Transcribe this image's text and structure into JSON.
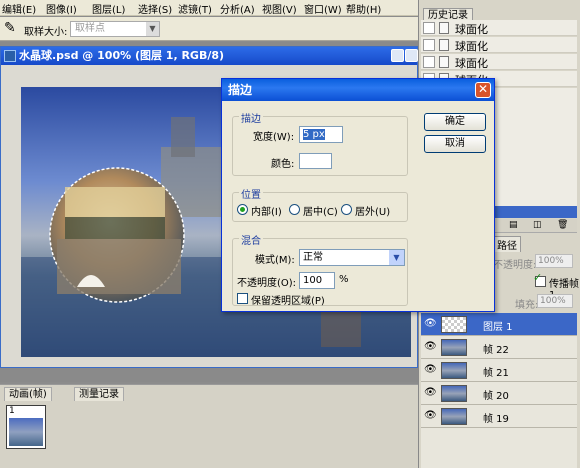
{
  "menubar": {
    "items": [
      "编辑(E)",
      "图像(I)",
      "图层(L)",
      "选择(S)",
      "滤镜(T)",
      "分析(A)",
      "视图(V)",
      "窗口(W)",
      "帮助(H)"
    ]
  },
  "optbar": {
    "sample_size_label": "取样大小:",
    "sample_size_value": "取样点"
  },
  "document": {
    "title": "水晶球.psd @ 100% (图层 1, RGB/8)"
  },
  "history": {
    "tab": "历史记录",
    "items": [
      "球面化",
      "球面化",
      "球面化",
      "球面化"
    ]
  },
  "layers": {
    "partial_tab": "路径",
    "opacity_label": "不透明度:",
    "opacity_value": "100%",
    "propagate_label": "传播帧 1",
    "fill_label": "填充:",
    "fill_value": "100%",
    "rows": [
      {
        "label": "图层 1"
      },
      {
        "label": "帧 22"
      },
      {
        "label": "帧 21"
      },
      {
        "label": "帧 20"
      },
      {
        "label": "帧 19"
      }
    ]
  },
  "animation": {
    "tab_animation": "动画(帧)",
    "tab_measure": "测量记录",
    "frame_number": "1"
  },
  "dialog": {
    "title": "描边",
    "close": "✕",
    "stroke_group": "描边",
    "width_label": "宽度(W):",
    "width_value": "5 px",
    "color_label": "颜色:",
    "position_group": "位置",
    "inside": "内部(I)",
    "center": "居中(C)",
    "outside": "居外(U)",
    "blend_group": "混合",
    "mode_label": "模式(M):",
    "mode_value": "正常",
    "opacity_label": "不透明度(O):",
    "opacity_value": "100",
    "opacity_unit": "%",
    "preserve_label": "保留透明区域(P)",
    "ok": "确定",
    "cancel": "取消"
  },
  "colors": {
    "title_bar": "#1649c9",
    "dialog_bg": "#ece9d8",
    "selection": "#3b67c7"
  }
}
